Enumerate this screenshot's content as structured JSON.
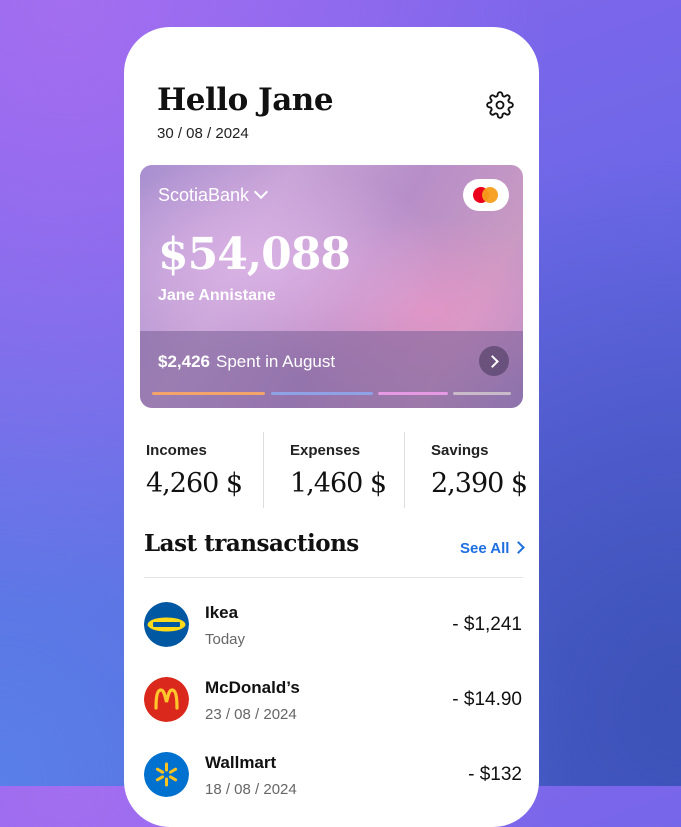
{
  "header": {
    "greeting": "Hello Jane",
    "date": "30 / 08 / 2024"
  },
  "card": {
    "bank": "ScotiaBank",
    "balance": "$54,088",
    "holder": "Jane Annistane",
    "spent_amount": "$2,426",
    "spent_label": "Spent in August",
    "network_icon": "mastercard-icon",
    "bar_colors": [
      "#f3a46a",
      "#8fa2e6",
      "#e69ae3",
      "#c9bac9"
    ]
  },
  "stats": [
    {
      "label": "Incomes",
      "value": "4,260 $"
    },
    {
      "label": "Expenses",
      "value": "1,460 $"
    },
    {
      "label": "Savings",
      "value": "2,390 $"
    }
  ],
  "transactions_section": {
    "title": "Last transactions",
    "see_all": "See All"
  },
  "transactions": [
    {
      "name": "Ikea",
      "date": "Today",
      "amount": "- $1,241",
      "logo": "ikea-logo"
    },
    {
      "name": "McDonald’s",
      "date": "23 / 08 / 2024",
      "amount": "- $14.90",
      "logo": "mcdonalds-logo"
    },
    {
      "name": "Wallmart",
      "date": "18 / 08 / 2024",
      "amount": "- $132",
      "logo": "walmart-logo"
    }
  ],
  "colors": {
    "accent": "#1e6fe0",
    "background_top": "#8a66ee",
    "background_bottom": "#4a5fcf"
  }
}
